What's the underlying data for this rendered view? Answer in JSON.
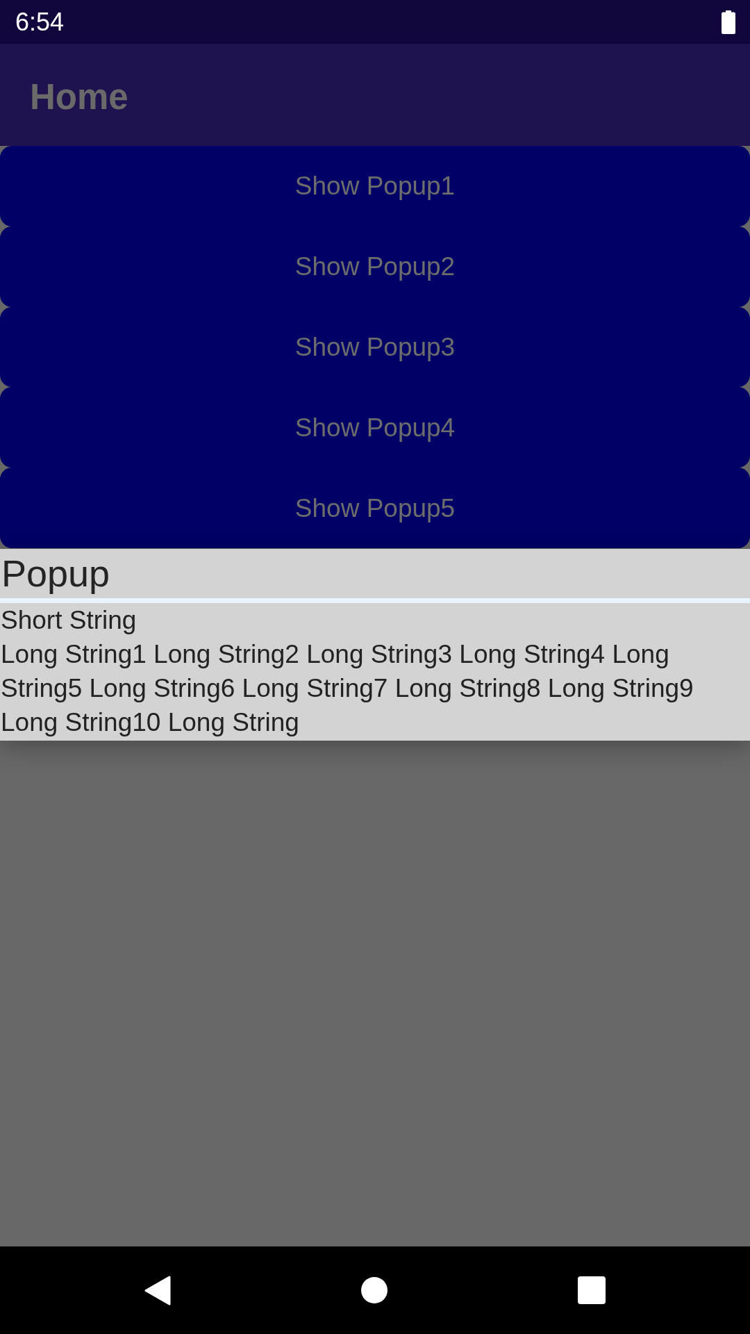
{
  "status_bar": {
    "time": "6:54"
  },
  "app_bar": {
    "title": "Home"
  },
  "buttons": [
    "Show Popup1",
    "Show Popup2",
    "Show Popup3",
    "Show Popup4",
    "Show Popup5"
  ],
  "popup": {
    "title": "Popup",
    "lines": [
      "Short String",
      "Long String1 Long String2 Long String3 Long String4 Long String5 Long String6 Long String7 Long String8 Long String9 Long String10 Long String"
    ]
  }
}
